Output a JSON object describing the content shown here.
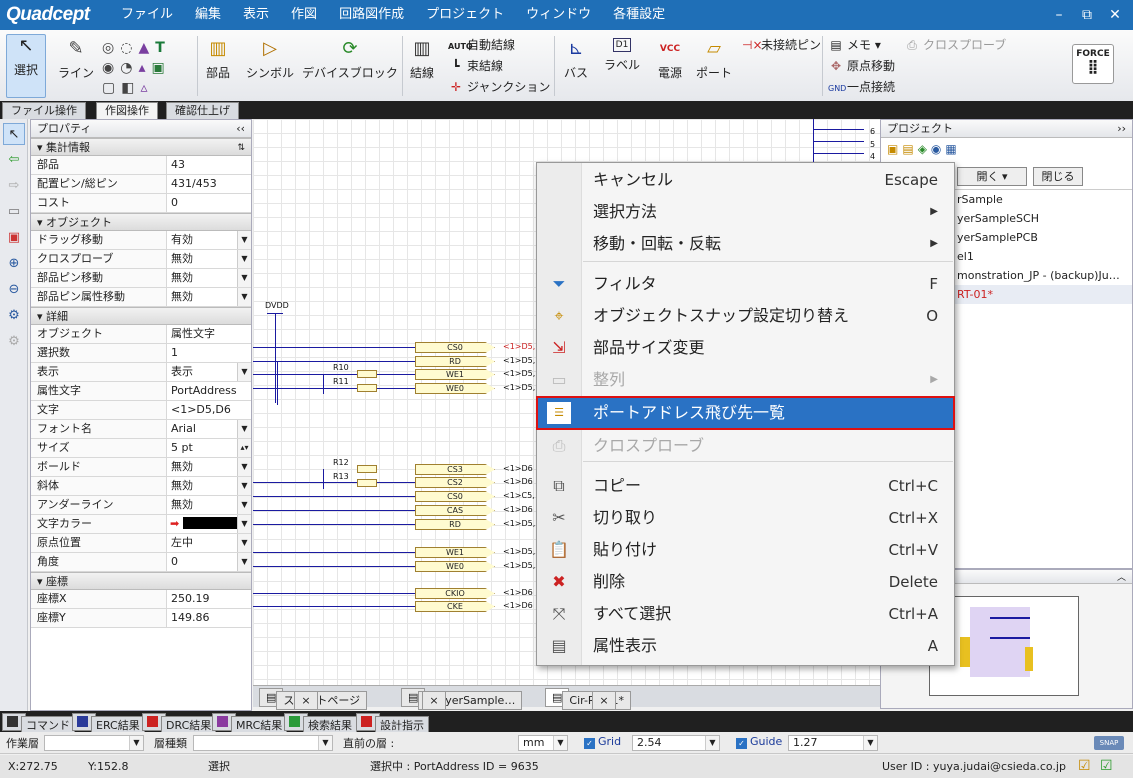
{
  "app": {
    "logo": "Quadcept"
  },
  "menu": [
    "ファイル",
    "編集",
    "表示",
    "作図",
    "回路図作成",
    "プロジェクト",
    "ウィンドウ",
    "各種設定"
  ],
  "window_controls": [
    "minimize-icon",
    "restore-icon",
    "close-icon"
  ],
  "ribbon": {
    "select": "選択",
    "line": "ライン",
    "part": "部品",
    "symbol": "シンボル",
    "device_block": "デバイスブロック",
    "wire": "結線",
    "auto_wire": "自動結線",
    "bundle_wire": "束結線",
    "junction": "ジャンクション",
    "bus": "バス",
    "label": "ラベル",
    "power": "電源",
    "port": "ポート",
    "unconnected_pin": "未接続ピン",
    "memo": "メモ",
    "origin_move": "原点移動",
    "one_point": "一点接続",
    "cross_probe": "クロスプローブ",
    "force": "FORCE"
  },
  "ribbon_tabs": [
    "ファイル操作",
    "作図操作",
    "確認仕上げ"
  ],
  "properties": {
    "title": "プロパティ",
    "groups": {
      "summary": "集計情報",
      "object": "オブジェクト",
      "detail": "詳細",
      "coord": "座標"
    },
    "summary_rows": [
      {
        "k": "部品",
        "v": "43"
      },
      {
        "k": "配置ピン/総ピン",
        "v": "431/453"
      },
      {
        "k": "コスト",
        "v": "0"
      }
    ],
    "object_rows": [
      {
        "k": "ドラッグ移動",
        "v": "有効"
      },
      {
        "k": "クロスプローブ",
        "v": "無効"
      },
      {
        "k": "部品ピン移動",
        "v": "無効"
      },
      {
        "k": "部品ピン属性移動",
        "v": "無効"
      }
    ],
    "detail_rows": [
      {
        "k": "オブジェクト",
        "v": "属性文字"
      },
      {
        "k": "選択数",
        "v": "1"
      },
      {
        "k": "表示",
        "v": "表示"
      },
      {
        "k": "属性文字",
        "v": "PortAddress"
      },
      {
        "k": "文字",
        "v": "<1>D5,D6"
      },
      {
        "k": "フォント名",
        "v": "Arial"
      },
      {
        "k": "サイズ",
        "v": "5 pt"
      },
      {
        "k": "ボールド",
        "v": "無効"
      },
      {
        "k": "斜体",
        "v": "無効"
      },
      {
        "k": "アンダーライン",
        "v": "無効"
      },
      {
        "k": "文字カラー",
        "v": ""
      },
      {
        "k": "原点位置",
        "v": "左中"
      },
      {
        "k": "角度",
        "v": "0"
      }
    ],
    "coord_rows": [
      {
        "k": "座標X",
        "v": "250.19"
      },
      {
        "k": "座標Y",
        "v": "149.86"
      }
    ]
  },
  "schematic": {
    "net_label": "DVDD",
    "ports_top": [
      {
        "name": "CS0",
        "addr": "<1>D5,"
      },
      {
        "name": "RD",
        "addr": "<1>D5,"
      },
      {
        "name": "WE1",
        "addr": "<1>D5,"
      },
      {
        "name": "WE0",
        "addr": "<1>D5,"
      }
    ],
    "ports_mid": [
      {
        "name": "CS3",
        "addr": "<1>D6"
      },
      {
        "name": "CS2",
        "addr": "<1>D6"
      },
      {
        "name": "CS0",
        "addr": "<1>C5,"
      },
      {
        "name": "CAS",
        "addr": "<1>D6"
      },
      {
        "name": "RD",
        "addr": "<1>D5,"
      }
    ],
    "ports_low": [
      {
        "name": "WE1",
        "addr": "<1>D5,"
      },
      {
        "name": "WE0",
        "addr": "<1>D5,"
      }
    ],
    "ports_bot": [
      {
        "name": "CKIO",
        "addr": "<1>D6"
      },
      {
        "name": "CKE",
        "addr": "<1>D6"
      }
    ],
    "resistors": [
      "R10",
      "R11",
      "R12",
      "R13"
    ],
    "right_numbers": [
      "6",
      "5",
      "4"
    ]
  },
  "context_menu": [
    {
      "label": "キャンセル",
      "shortcut": "Escape",
      "icon": "",
      "disabled": false,
      "highlight": false,
      "arrow": false
    },
    {
      "label": "選択方法",
      "shortcut": "",
      "icon": "",
      "disabled": false,
      "highlight": false,
      "arrow": true
    },
    {
      "label": "移動・回転・反転",
      "shortcut": "",
      "icon": "",
      "disabled": false,
      "highlight": false,
      "arrow": true
    },
    {
      "label": "フィルタ",
      "shortcut": "F",
      "icon": "filter-icon",
      "disabled": false,
      "highlight": false,
      "arrow": false
    },
    {
      "label": "オブジェクトスナップ設定切り替え",
      "shortcut": "O",
      "icon": "snap-icon",
      "disabled": false,
      "highlight": false,
      "arrow": false
    },
    {
      "label": "部品サイズ変更",
      "shortcut": "",
      "icon": "resize-icon",
      "disabled": false,
      "highlight": false,
      "arrow": false
    },
    {
      "label": "整列",
      "shortcut": "",
      "icon": "align-icon",
      "disabled": true,
      "highlight": false,
      "arrow": true
    },
    {
      "label": "ポートアドレス飛び先一覧",
      "shortcut": "",
      "icon": "list-icon",
      "disabled": false,
      "highlight": true,
      "arrow": false
    },
    {
      "label": "クロスプローブ",
      "shortcut": "",
      "icon": "crossprobe-icon",
      "disabled": true,
      "highlight": false,
      "arrow": false
    },
    {
      "label": "コピー",
      "shortcut": "Ctrl+C",
      "icon": "copy-icon",
      "disabled": false,
      "highlight": false,
      "arrow": false
    },
    {
      "label": "切り取り",
      "shortcut": "Ctrl+X",
      "icon": "cut-icon",
      "disabled": false,
      "highlight": false,
      "arrow": false
    },
    {
      "label": "貼り付け",
      "shortcut": "Ctrl+V",
      "icon": "paste-icon",
      "disabled": false,
      "highlight": false,
      "arrow": false
    },
    {
      "label": "削除",
      "shortcut": "Delete",
      "icon": "delete-icon",
      "disabled": false,
      "highlight": false,
      "arrow": false
    },
    {
      "label": "すべて選択",
      "shortcut": "Ctrl+A",
      "icon": "select-all-icon",
      "disabled": false,
      "highlight": false,
      "arrow": false
    },
    {
      "label": "属性表示",
      "shortcut": "A",
      "icon": "attribute-icon",
      "disabled": false,
      "highlight": false,
      "arrow": false
    }
  ],
  "doc_tabs": [
    "スタートページ",
    "4LayerSample…",
    "Cir-RT-01*"
  ],
  "project": {
    "title": "プロジェクト",
    "open": "開く",
    "close": "閉じる",
    "items": [
      "rSample",
      "yerSampleSCH",
      "yerSamplePCB",
      "el1",
      "monstration_JP - (backup)Ju…",
      "RT-01*"
    ]
  },
  "bottom_tabs": [
    "コマンド",
    "ERC結果",
    "DRC結果",
    "MRC結果",
    "検索結果",
    "設計指示"
  ],
  "layer_bar": {
    "work_layer": "作業層",
    "layer_type": "層種類",
    "prev_layer": "直前の層 :",
    "unit": "mm",
    "grid_label": "Grid",
    "grid_value": "2.54",
    "guide_label": "Guide",
    "guide_value": "1.27",
    "snap": "SNAP"
  },
  "status": {
    "x": "X:272.75",
    "y": "Y:152.8",
    "mode": "選択",
    "selection": "選択中 : PortAddress ID = 9635",
    "user": "User ID : yuya.judai@csieda.co.jp"
  },
  "colors": {
    "titlebar": "#1f6fb7",
    "highlight": "#2a72c4",
    "wire": "#1a1aa0"
  }
}
